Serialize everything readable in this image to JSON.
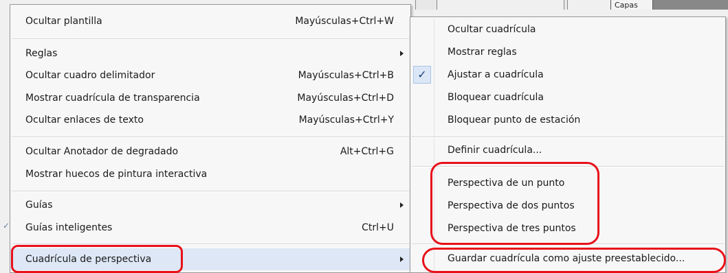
{
  "background": {
    "layers_tab": "Capas"
  },
  "main_menu": {
    "items": [
      {
        "label": "Ocultar plantilla",
        "shortcut": "Mayúsculas+Ctrl+W"
      },
      {
        "label": "Reglas",
        "shortcut": ""
      },
      {
        "label": "Ocultar cuadro delimitador",
        "shortcut": "Mayúsculas+Ctrl+B"
      },
      {
        "label": "Mostrar cuadrícula de transparencia",
        "shortcut": "Mayúsculas+Ctrl+D"
      },
      {
        "label": "Ocultar enlaces de texto",
        "shortcut": "Mayúsculas+Ctrl+Y"
      },
      {
        "label": "Ocultar Anotador de degradado",
        "shortcut": "Alt+Ctrl+G"
      },
      {
        "label": "Mostrar huecos de pintura interactiva",
        "shortcut": ""
      },
      {
        "label": "Guías",
        "shortcut": ""
      },
      {
        "label": "Guías inteligentes",
        "shortcut": "Ctrl+U"
      },
      {
        "label": "Cuadrícula de perspectiva",
        "shortcut": ""
      }
    ]
  },
  "sub_menu": {
    "items": [
      {
        "label": "Ocultar cuadrícula",
        "checked": false
      },
      {
        "label": "Mostrar reglas",
        "checked": false
      },
      {
        "label": "Ajustar a cuadrícula",
        "checked": true
      },
      {
        "label": "Bloquear cuadrícula",
        "checked": false
      },
      {
        "label": "Bloquear punto de estación",
        "checked": false
      },
      {
        "label": "Definir cuadrícula...",
        "checked": false
      },
      {
        "label": "Perspectiva de un punto",
        "checked": false
      },
      {
        "label": "Perspectiva de dos puntos",
        "checked": false
      },
      {
        "label": "Perspectiva de tres puntos",
        "checked": false
      },
      {
        "label": "Guardar cuadrícula como ajuste preestablecido...",
        "checked": false
      }
    ]
  },
  "checkmark_glyph": "✓",
  "annotation_color": "#e8101a"
}
